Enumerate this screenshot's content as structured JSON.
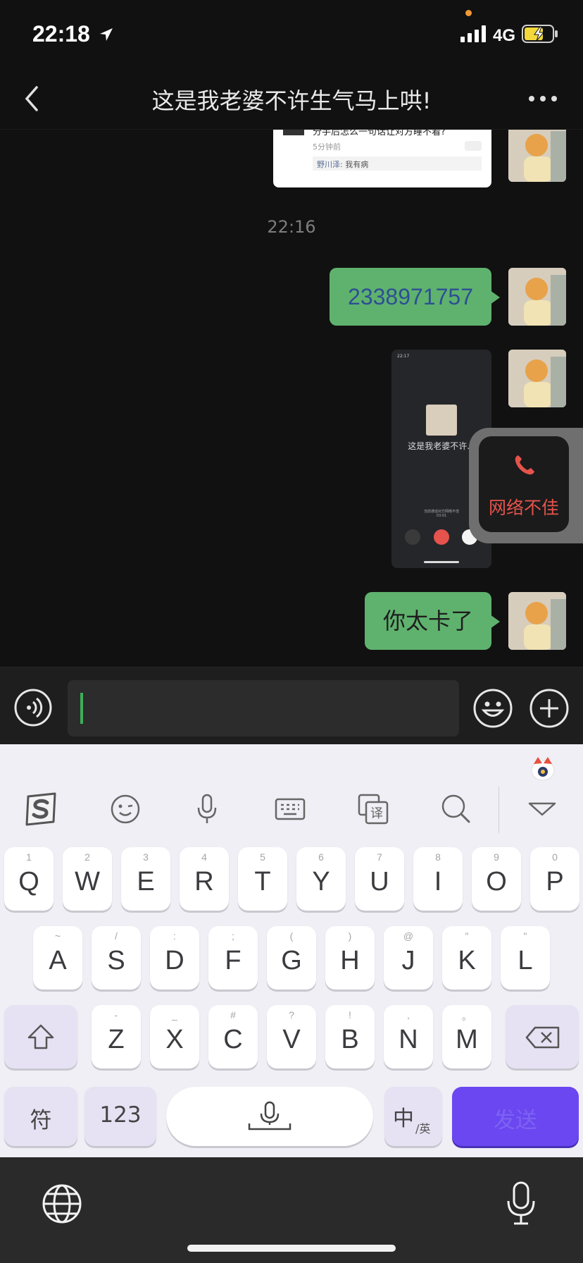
{
  "status": {
    "time": "22:18",
    "network": "4G"
  },
  "header": {
    "title": "这是我老婆不许生气马上哄!"
  },
  "messages": {
    "shared_card": {
      "question": "分手后怎么一句话让对方睡不着?",
      "time_ago": "5分钟前",
      "reply_name": "野川泽:",
      "reply_text": "我有病"
    },
    "timestamp": "22:16",
    "number_message": "2338971757",
    "screenshot": {
      "time": "22:17",
      "name": "这是我老婆不许...",
      "status_text": "当前通话对方网络不佳",
      "duration": "03:01"
    },
    "last_message": "你太卡了"
  },
  "floating_call": {
    "label": "网络不佳",
    "color": "#e5534b"
  },
  "keyboard": {
    "row1": [
      {
        "hint": "1",
        "main": "Q"
      },
      {
        "hint": "2",
        "main": "W"
      },
      {
        "hint": "3",
        "main": "E"
      },
      {
        "hint": "4",
        "main": "R"
      },
      {
        "hint": "5",
        "main": "T"
      },
      {
        "hint": "6",
        "main": "Y"
      },
      {
        "hint": "7",
        "main": "U"
      },
      {
        "hint": "8",
        "main": "I"
      },
      {
        "hint": "9",
        "main": "O"
      },
      {
        "hint": "0",
        "main": "P"
      }
    ],
    "row2": [
      {
        "hint": "~",
        "main": "A"
      },
      {
        "hint": "/",
        "main": "S"
      },
      {
        "hint": ":",
        "main": "D"
      },
      {
        "hint": ";",
        "main": "F"
      },
      {
        "hint": "(",
        "main": "G"
      },
      {
        "hint": ")",
        "main": "H"
      },
      {
        "hint": "@",
        "main": "J"
      },
      {
        "hint": "\"",
        "main": "K"
      },
      {
        "hint": "\"",
        "main": "L"
      }
    ],
    "row3": [
      {
        "hint": "-",
        "main": "Z"
      },
      {
        "hint": "_",
        "main": "X"
      },
      {
        "hint": "#",
        "main": "C"
      },
      {
        "hint": "?",
        "main": "V"
      },
      {
        "hint": "!",
        "main": "B"
      },
      {
        "hint": ",",
        "main": "N"
      },
      {
        "hint": "。",
        "main": "M"
      }
    ],
    "symbols_label": "符",
    "numbers_label": "123",
    "lang_main": "中",
    "lang_sub": "/英",
    "send_label": "发送",
    "accent": "#6a47f0"
  },
  "icons": [
    "location-arrow-icon",
    "signal-icon",
    "battery-icon",
    "back-icon",
    "more-icon",
    "voice-icon",
    "emoji-icon",
    "plus-icon",
    "sogou-logo-icon",
    "emoji-face-icon",
    "mic-icon",
    "keyboard-icon",
    "translate-icon",
    "search-icon",
    "collapse-icon",
    "shift-icon",
    "delete-icon",
    "globe-icon",
    "dictation-icon"
  ]
}
